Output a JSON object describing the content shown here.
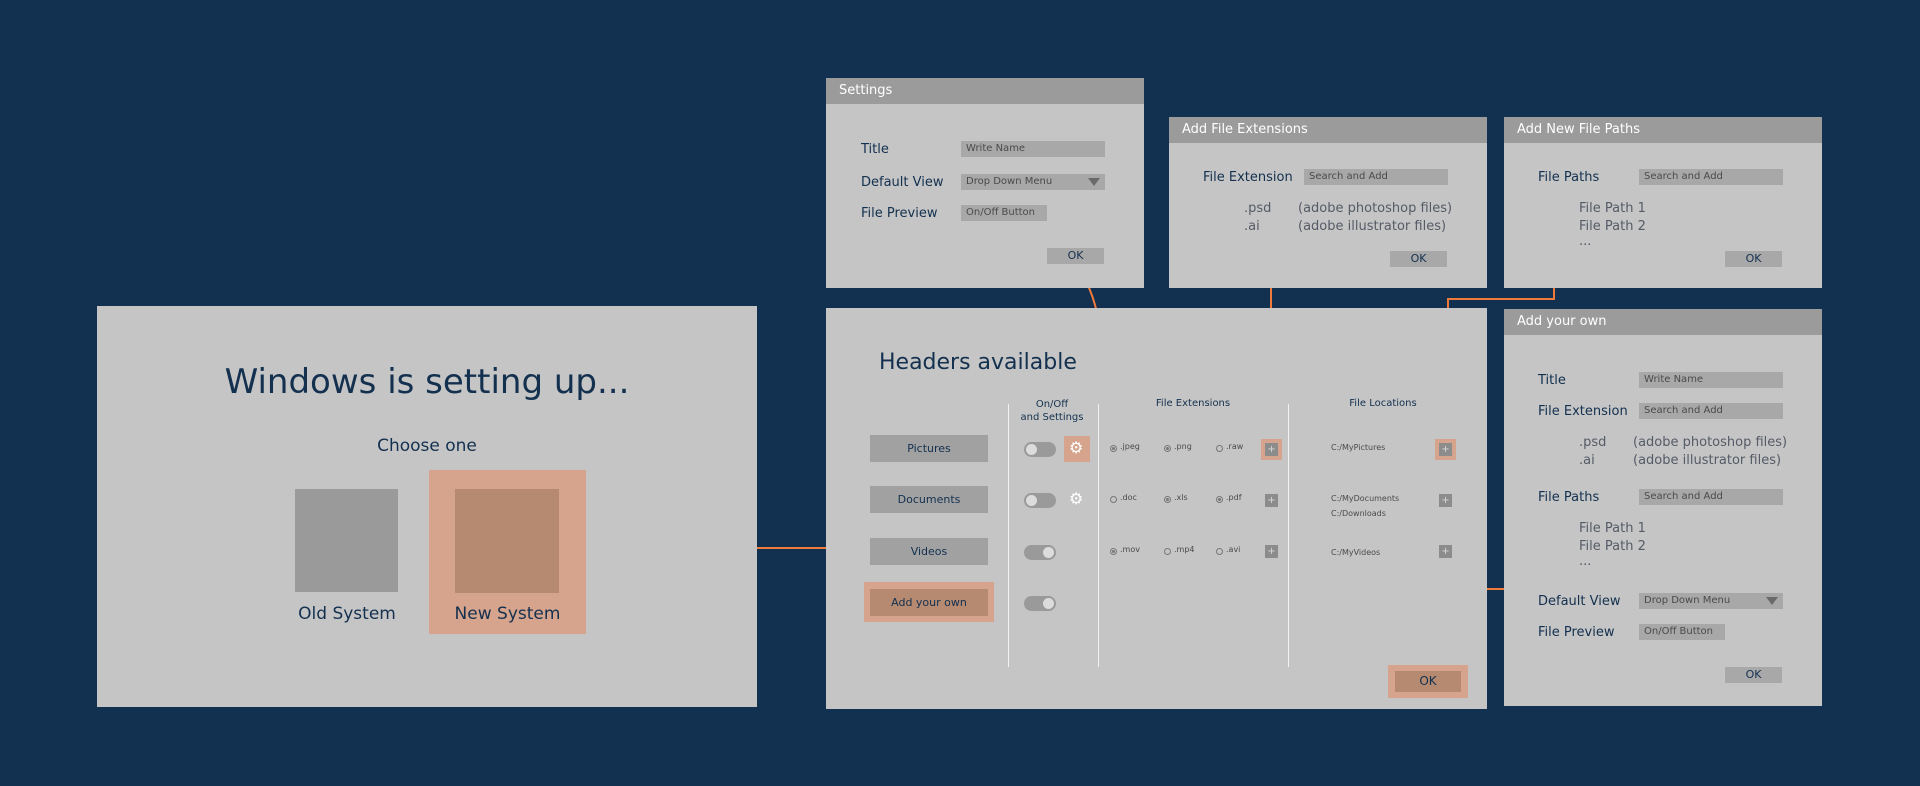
{
  "colors": {
    "background": "#12304f",
    "panel": "#c5c5c5",
    "titlebar": "#9b9b9b",
    "accent_line": "#f07a3a",
    "highlight": "#d6a48c",
    "text": "#13304f"
  },
  "setup": {
    "title": "Windows is setting up...",
    "subtitle": "Choose one",
    "options": [
      "Old System",
      "New System"
    ]
  },
  "settings": {
    "window_title": "Settings",
    "title_label": "Title",
    "title_placeholder": "Write Name",
    "default_view_label": "Default View",
    "default_view_value": "Drop Down Menu",
    "file_preview_label": "File Preview",
    "file_preview_value": "On/Off Button",
    "ok": "OK"
  },
  "add_ext": {
    "window_title": "Add File Extensions",
    "label": "File Extension",
    "placeholder": "Search and Add",
    "items": [
      {
        "ext": ".psd",
        "desc": "(adobe photoshop files)"
      },
      {
        "ext": ".ai",
        "desc": "(adobe illustrator files)"
      }
    ],
    "ok": "OK"
  },
  "add_paths": {
    "window_title": "Add New File Paths",
    "label": "File Paths",
    "placeholder": "Search and Add",
    "items": [
      "File Path 1",
      "File Path 2",
      "..."
    ],
    "ok": "OK"
  },
  "headers": {
    "title": "Headers available",
    "col_onoff": [
      "On/Off",
      "and Settings"
    ],
    "col_ext": "File Extensions",
    "col_loc": "File Locations",
    "rows": [
      {
        "label": "Pictures",
        "exts": [
          ".jpeg",
          ".png",
          ".raw"
        ],
        "locations": [
          "C:/MyPictures"
        ]
      },
      {
        "label": "Documents",
        "exts": [
          ".doc",
          ".xls",
          ".pdf"
        ],
        "locations": [
          "C:/MyDocuments",
          "C:/Downloads"
        ]
      },
      {
        "label": "Videos",
        "exts": [
          ".mov",
          ".mp4",
          ".avi"
        ],
        "locations": [
          "C:/MyVideos"
        ]
      }
    ],
    "add_own": "Add your own",
    "ok": "OK"
  },
  "add_own": {
    "window_title": "Add your own",
    "title_label": "Title",
    "title_placeholder": "Write Name",
    "ext_label": "File Extension",
    "ext_placeholder": "Search and Add",
    "ext_items": [
      {
        "ext": ".psd",
        "desc": "(adobe photoshop files)"
      },
      {
        "ext": ".ai",
        "desc": "(adobe illustrator files)"
      }
    ],
    "paths_label": "File Paths",
    "paths_placeholder": "Search and Add",
    "path_items": [
      "File Path 1",
      "File Path 2",
      "..."
    ],
    "default_view_label": "Default View",
    "default_view_value": "Drop Down Menu",
    "file_preview_label": "File Preview",
    "file_preview_value": "On/Off Button",
    "ok": "OK"
  }
}
